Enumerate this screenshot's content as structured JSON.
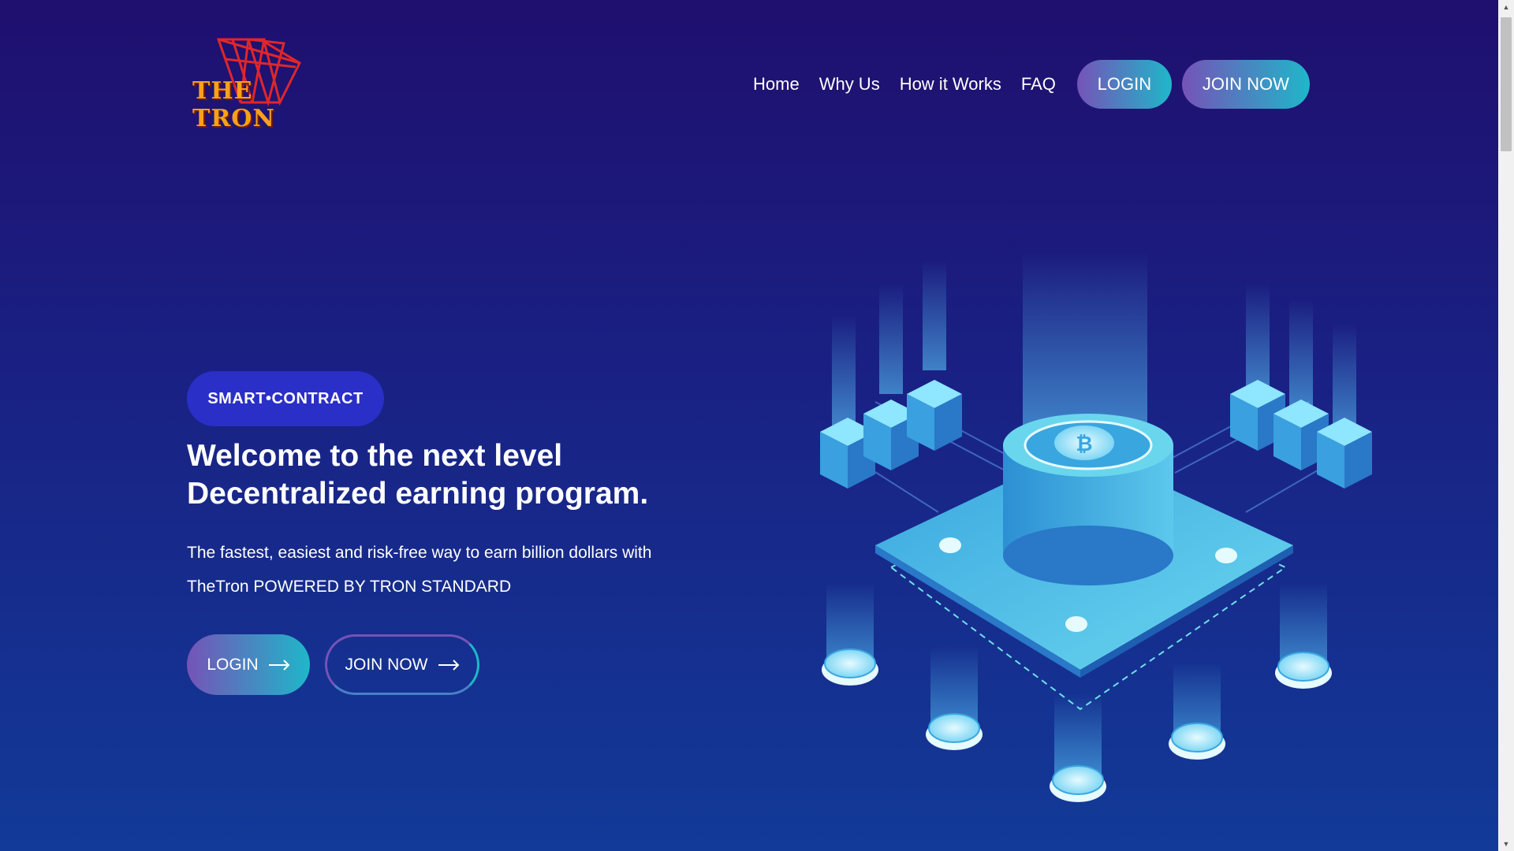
{
  "brand": {
    "logo_text": "THE TRON"
  },
  "nav": {
    "links": [
      "Home",
      "Why Us",
      "How it Works",
      "FAQ"
    ],
    "login_label": "LOGIN",
    "join_label": "JOIN NOW"
  },
  "hero": {
    "badge": "SMART•CONTRACT",
    "headline_line1": "Welcome to the next level",
    "headline_line2": "Decentralized earning program.",
    "subtext_line1": "The fastest, easiest and risk-free way to earn billion dollars with",
    "subtext_line2": "TheTron POWERED BY TRON STANDARD",
    "login_label": "LOGIN",
    "join_label": "JOIN NOW"
  },
  "colors": {
    "bg_top": "#1f0f6e",
    "bg_bottom": "#123a98",
    "accent_purple": "#7553b8",
    "accent_cyan": "#1fb7c9",
    "badge_bg": "#2a2fc7",
    "logo_red": "#e0262a",
    "logo_orange": "#f6a21a"
  }
}
